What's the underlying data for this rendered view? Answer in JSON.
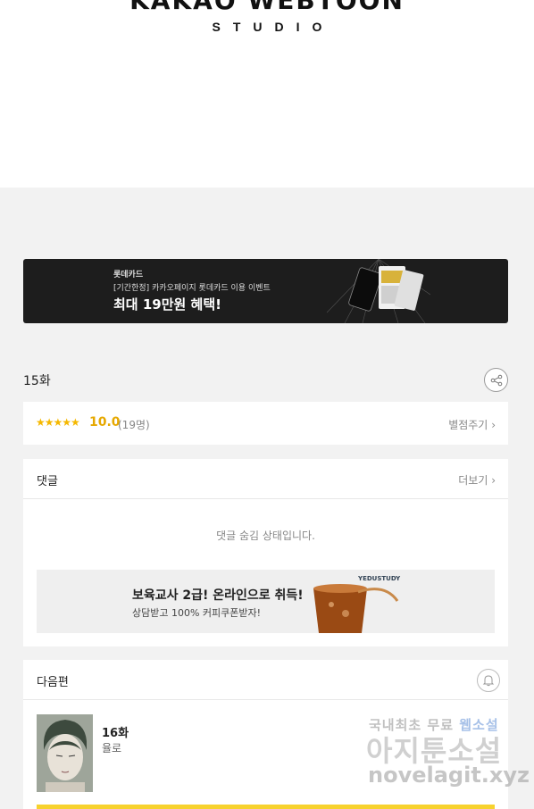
{
  "header": {
    "logo_main": "KAKAO WEBTOON",
    "logo_sub": "STUDIO"
  },
  "banner": {
    "line1": "롯데카드",
    "line2": "[기간한정] 카카오페이지 롯데카드 이용 이벤트",
    "line3": "최대 19만원 혜택!"
  },
  "episode": {
    "title": "15화"
  },
  "rating": {
    "stars": "★★★★★",
    "score": "10.0",
    "count": "(19명)",
    "rate_label": "별점주기",
    "rate_chevron": "›"
  },
  "comments": {
    "title": "댓글",
    "more_label": "더보기",
    "more_chevron": "›",
    "hidden_message": "댓글 숨김 상태입니다.",
    "ad": {
      "title": "보육교사 2급! 온라인으로 취득!",
      "subtitle": "상담받고 100% 커피쿠폰받자!",
      "brand": "YEDUSTUDY"
    }
  },
  "next": {
    "title": "다음편",
    "episode": "16화",
    "name": "율로"
  },
  "watermark": {
    "line1_gray": "국내최초 무료 ",
    "line1_blue": "웹소설",
    "line2": "아지툰소설",
    "line3": "novelagit.xyz"
  },
  "colors": {
    "accent_yellow": "#f7d22e",
    "star": "#f5b800",
    "banner_bg": "#1d1d1d"
  }
}
